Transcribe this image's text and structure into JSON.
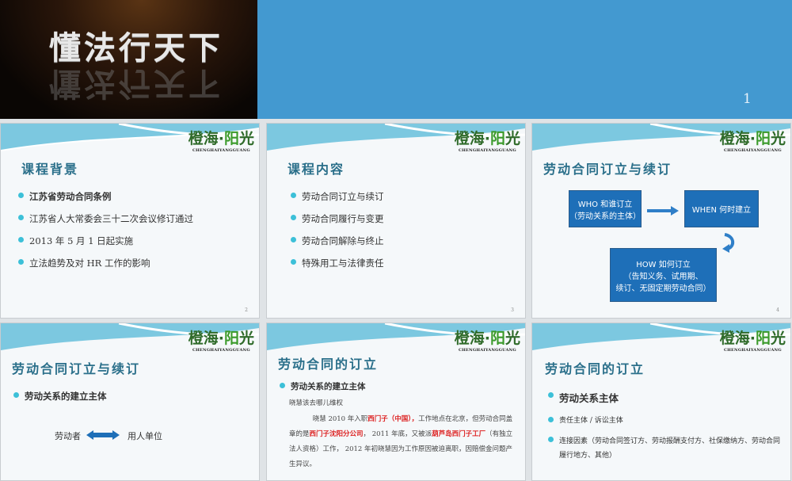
{
  "slides": [
    {
      "number": "1",
      "title": "懂法行天下"
    },
    {
      "number": "2",
      "title": "课程背景",
      "items": [
        "江苏省劳动合同条例",
        "江苏省人大常委会三十二次会议修订通过",
        "2013 年 5 月 1 日起实施",
        "立法趋势及对 HR 工作的影响"
      ]
    },
    {
      "number": "3",
      "title": "课程内容",
      "items": [
        "劳动合同订立与续订",
        "劳动合同履行与变更",
        "劳动合同解除与终止",
        "特殊用工与法律责任"
      ]
    },
    {
      "number": "4",
      "title": "劳动合同订立与续订",
      "boxes": {
        "who1": "WHO  和谁订立",
        "who2": "（劳动关系的主体）",
        "when": "WHEN  何时建立",
        "how1": "HOW   如何订立",
        "how2": "（告知义务、试用期、",
        "how3": "续订、无固定期劳动合同）"
      }
    },
    {
      "title": "劳动合同订立与续订",
      "bullet": "劳动关系的建立主体",
      "left": "劳动者",
      "right": "用人单位"
    },
    {
      "title": "劳动合同的订立",
      "bullet": "劳动关系的建立主体",
      "sub": "晓慧该去哪儿维权",
      "p": [
        "晓慧 2010 年入职",
        "西门子（中国），",
        "工作地点在北京，但劳动合同盖章的是",
        "西门子沈阳分公司",
        "， 2011 年底，又被派",
        "葫芦岛西门子工厂",
        "（有独立法人资格）工作， 2012 年初晓慧因为工作原因被迫离职，因赔偿金问题产生异议。"
      ]
    },
    {
      "title": "劳动合同的订立",
      "bullet": "劳动关系主体",
      "items": [
        "责任主体 / 诉讼主体",
        "连接因素（劳动合同签订方、劳动报酬支付方、社保缴纳方、劳动合同履行地方、其他）"
      ]
    }
  ],
  "logo": {
    "cn_a": "橙海·",
    "cn_b": "阳",
    "cn_c": "光",
    "en": "CHENGHAIYANGGUANG"
  }
}
